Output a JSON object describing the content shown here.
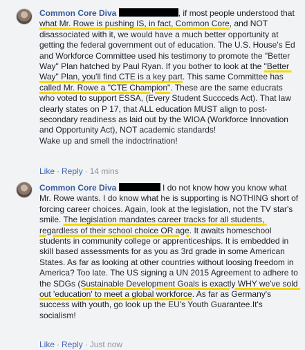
{
  "comments": [
    {
      "author": "Common Core Diva",
      "segments": [
        {
          "t": ", if most people understood that ",
          "hl": false
        },
        {
          "t": "what Mr. Rowe is pushing IS, in fact, Common Core",
          "hl": true
        },
        {
          "t": ", and NOT disassociated with it, we would have a much better opportunity at getting the federal government out of education. The U.S. House's Ed and Workforce Committee used his testimony to promote the \"Better Way\" Plan hatched by Paul Ryan. If you bother to look at the ",
          "hl": false
        },
        {
          "t": "\"Better Way\" Plan, you'll find CTE is a key part",
          "hl": true
        },
        {
          "t": ". This same Committee has ",
          "hl": false
        },
        {
          "t": "called Mr. Rowe a \"CTE Champion\"",
          "hl": true
        },
        {
          "t": ". These are the same educrats who voted to support ESSA, (Every Student Succceds Act). That law clearly states on P 17, that ALL education MUST align to post-secondary readiness as laid out by the WIOA (Workforce Innovation and Opportunity Act), NOT academic standards!\nWake up and smell the indoctrination!",
          "hl": false
        }
      ],
      "like": "Like",
      "reply": "Reply",
      "time": "14 mins"
    },
    {
      "author": "Common Core Diva",
      "segments": [
        {
          "t": " I do not know how you know what Mr. Rowe wants. I do know what he is supporting is NOTHING short of forcing career choices. Again, look at the legislation, not the TV star's smile. ",
          "hl": false
        },
        {
          "t": "The legislation mandates career tracks for all students, regardless of their school choice OR age",
          "hl": true
        },
        {
          "t": ". It awaits homeschool students in community college or apprenticeships. It is embedded in skill based assessments for as you as 3rd grade in some American States. As far as looking at other countries without loosing freedom in America? Too late. The US signing a UN 2015 Agreement to adhere to the SDGs ",
          "hl": false
        },
        {
          "t": "(Sustainable Development Goals is exactly WHY we've sold out 'education' to meet a global workforce",
          "hl": true
        },
        {
          "t": ". As far as Germany's success with youth, go look up the EU's Youth Guarantee.It's socialism!",
          "hl": false
        }
      ],
      "like": "Like",
      "reply": "Reply",
      "time": "Just now"
    }
  ],
  "colors": {
    "author": "#365899",
    "link": "#4267b2",
    "meta": "#90949c",
    "highlight": "#f5d90a",
    "background": "#f2f3f5"
  },
  "icons": {
    "avatar": "profile-photo",
    "redaction": "black-redaction-bar"
  }
}
